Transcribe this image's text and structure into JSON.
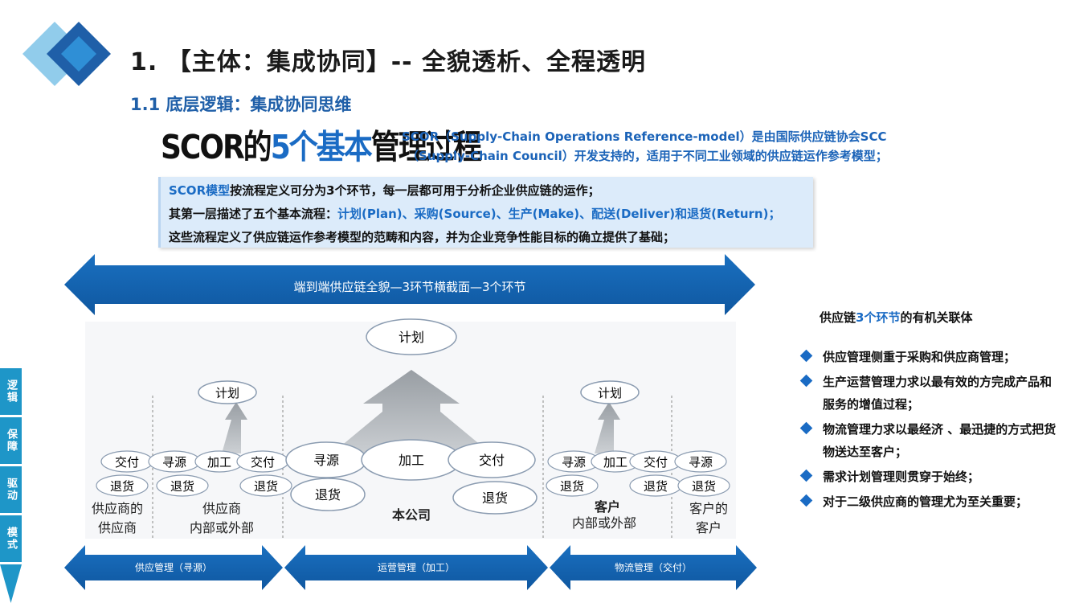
{
  "header": {
    "title": "1. 【主体：集成协同】-- 全貌透析、全程透明",
    "subtitle": "1.1 底层逻辑：集成协同思维"
  },
  "scor": {
    "heading_pre": "SCOR的",
    "heading_highlight": "5个基本",
    "heading_post": "管理过程",
    "desc_line1": "SCOR（Supply-Chain Operations Reference-model）是由国际供应链协会SCC",
    "desc_line2": "（Supply-Chain Council）开发支持的，适用于不同工业领域的供应链运作参考模型；"
  },
  "infobox": {
    "line1_highlight": "SCOR模型",
    "line1_rest": "按流程定义可分为3个环节，每一层都可用于分析企业供应链的运作；",
    "line2_pre": "其第一层描述了五个基本流程：",
    "line2_highlight": "计划(Plan)、采购(Source)、生产(Make)、配送(Deliver)和退货(Return)；",
    "line3": "这些流程定义了供应链运作参考模型的范畴和内容，并为企业竞争性能目标的确立提供了基础；"
  },
  "diagram": {
    "top_arrow_label": "端到端供应链全貌—3环节横截面—3个环节",
    "plan_center": "计划",
    "plan_left": "计划",
    "plan_right": "计划",
    "deliver": "交付",
    "source": "寻源",
    "make": "加工",
    "return": "退货",
    "entity_supplier_supplier_1": "供应商的",
    "entity_supplier_supplier_2": "供应商",
    "entity_supplier_1": "供应商",
    "entity_supplier_2": "内部或外部",
    "entity_company": "本公司",
    "entity_customer_1": "客户",
    "entity_customer_2": "内部或外部",
    "entity_customer_customer_1": "客户的",
    "entity_customer_customer_2": "客户",
    "bottom_arrows": [
      "供应管理（寻源）",
      "运营管理（加工）",
      "物流管理（交付）"
    ]
  },
  "right_panel": {
    "title_pre": "供应链",
    "title_highlight": "3个环节",
    "title_post": "的有机关联体",
    "bullets": [
      "供应管理侧重于采购和供应商管理；",
      "生产运营管理力求以最有效的方完成产品和服务的增值过程；",
      "物流管理力求以最经济 、最迅捷的方式把货物送达至客户；",
      "需求计划管理则贯穿于始终；",
      "对于二级供应商的管理尤为至关重要；"
    ]
  },
  "sidenav": {
    "items": [
      "逻辑",
      "保障",
      "驱动",
      "模式"
    ]
  },
  "colors": {
    "accent": "#1a6bc4",
    "arrow_dark": "#1565b0",
    "nav": "#1e96c8",
    "infobox_bg": "#dcebfa"
  }
}
